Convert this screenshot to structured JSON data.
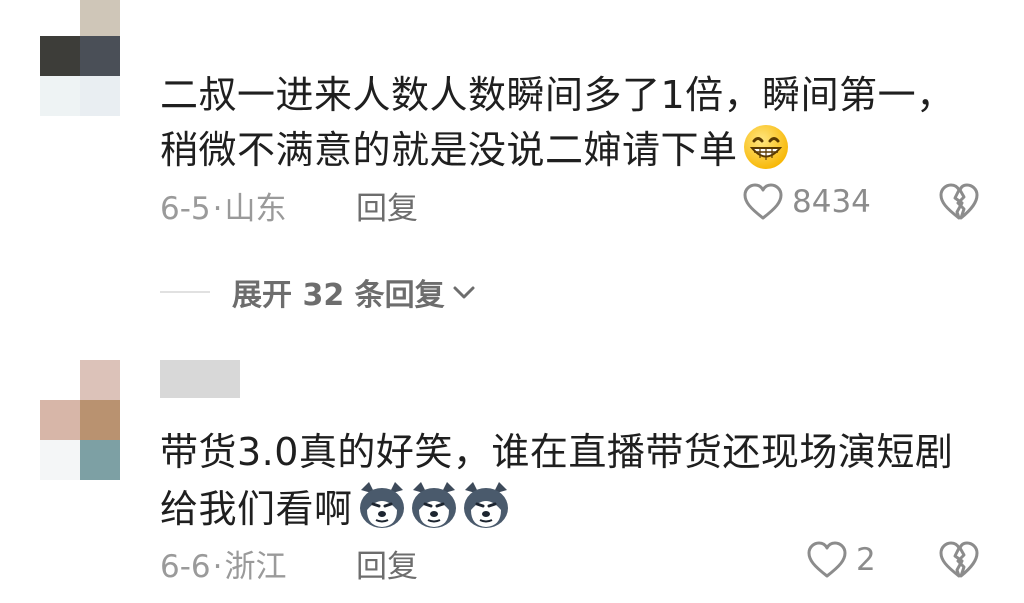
{
  "comments": [
    {
      "text_line1": "二叔一进来人数人数瞬间多了1倍，瞬间第一，",
      "text_line2": "稍微不满意的就是没说二婶请下单",
      "date": "6-5",
      "location": "山东",
      "reply_label": "回复",
      "likes": "8434",
      "emoji": "grinning-face"
    },
    {
      "text_line1": "带货3.0真的好笑，谁在直播带货还现场演短剧",
      "text_line2": "给我们看啊",
      "date": "6-6",
      "location": "浙江",
      "reply_label": "回复",
      "likes": "2",
      "emoji": "husky-face"
    }
  ],
  "expand_replies": {
    "label": "展开 32 条回复"
  },
  "colors": {
    "meta": "#9a9a9a",
    "reply": "#6d6d6d",
    "text": "#1f1f1f"
  }
}
